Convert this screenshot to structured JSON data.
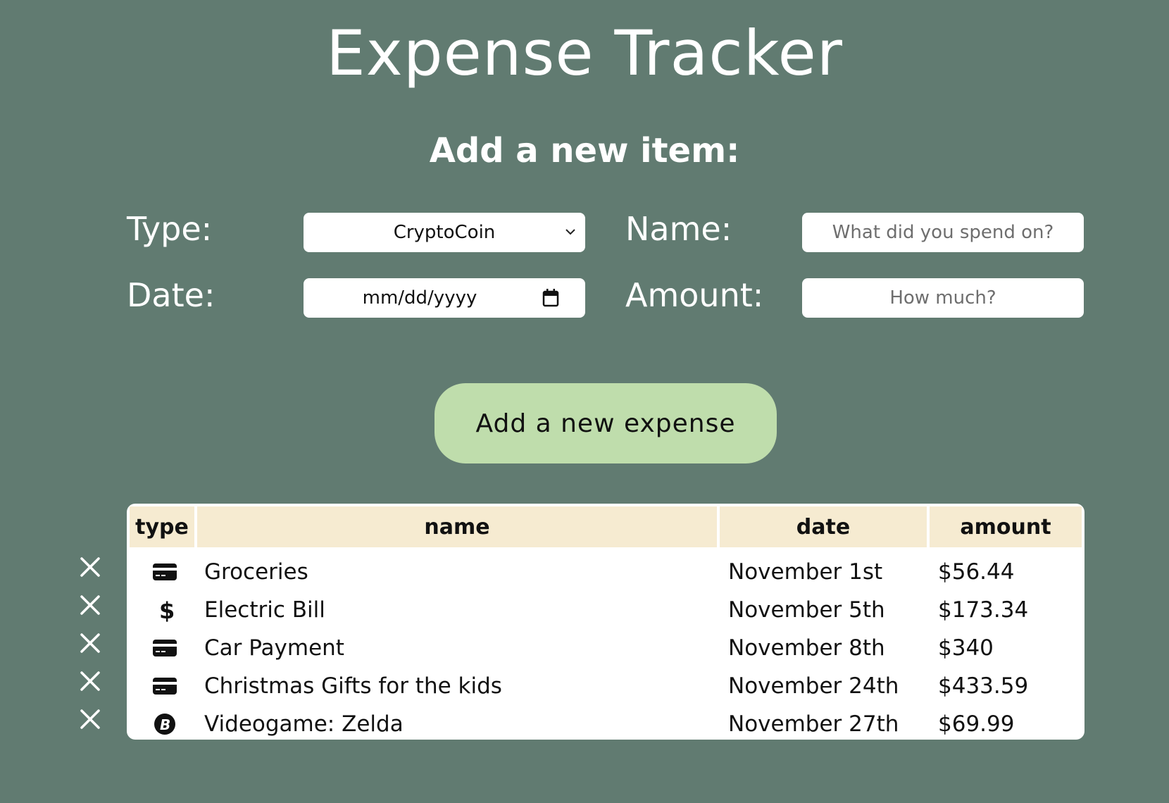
{
  "header": {
    "title": "Expense Tracker",
    "subtitle": "Add a new item:"
  },
  "form": {
    "type_label": "Type:",
    "type_value": "CryptoCoin",
    "name_label": "Name:",
    "name_placeholder": "What did you spend on?",
    "date_label": "Date:",
    "date_placeholder": "mm/dd/yyyy",
    "amount_label": "Amount:",
    "amount_placeholder": "How much?",
    "submit_label": "Add a new expense"
  },
  "table": {
    "columns": [
      "type",
      "name",
      "date",
      "amount"
    ],
    "rows": [
      {
        "type_icon": "credit-card-icon",
        "name": "Groceries",
        "date": "November 1st",
        "amount": "$56.44"
      },
      {
        "type_icon": "dollar-icon",
        "name": "Electric Bill",
        "date": "November 5th",
        "amount": "$173.34"
      },
      {
        "type_icon": "credit-card-icon",
        "name": "Car Payment",
        "date": "November 8th",
        "amount": "$340"
      },
      {
        "type_icon": "credit-card-icon",
        "name": "Christmas Gifts for the kids",
        "date": "November 24th",
        "amount": "$433.59"
      },
      {
        "type_icon": "bitcoin-icon",
        "name": "Videogame: Zelda",
        "date": "November 27th",
        "amount": "$69.99"
      }
    ]
  },
  "colors": {
    "background": "#617b71",
    "button": "#bfddac",
    "table_header": "#f6ebd1"
  }
}
